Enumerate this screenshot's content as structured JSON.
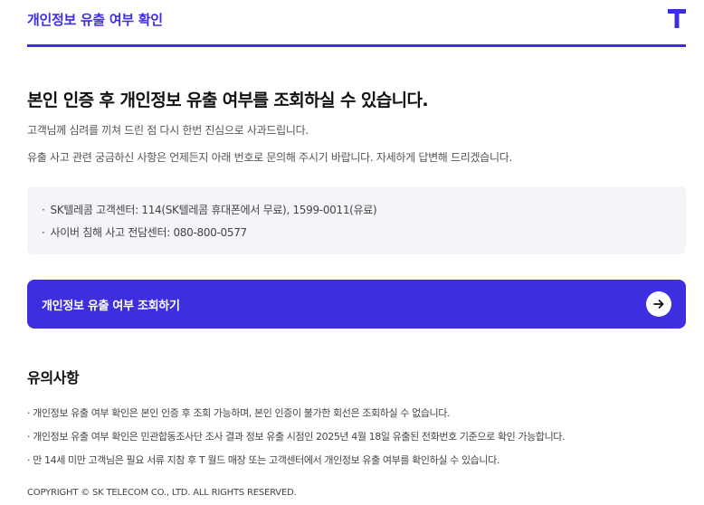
{
  "header": {
    "title": "개인정보 유출 여부 확인",
    "logo_icon": "t-logo-icon"
  },
  "main": {
    "headline": "본인 인증 후 개인정보 유출 여부를 조회하실 수 있습니다.",
    "description": [
      "고객님께 심려를 끼쳐 드린 점 다시 한번 진심으로 사과드립니다.",
      "유출 사고 관련 궁금하신 사항은 언제든지 아래 번호로 문의해 주시기 바랍니다. 자세하게 답변해 드리겠습니다."
    ],
    "contacts": [
      "SK텔레콤 고객센터: 114(SK텔레콤 휴대폰에서 무료), 1599-0011(유료)",
      "사이버 침해 사고 전담센터: 080-800-0577"
    ],
    "contact_bullet": "·",
    "cta": {
      "label": "개인정보 유출 여부 조회하기",
      "icon": "arrow-right-icon"
    }
  },
  "notes": {
    "title": "유의사항",
    "items": [
      "· 개인정보 유출 여부 확인은 본인 인증 후 조회 가능하며, 본인 인증이 불가한 회선은 조회하실 수 없습니다.",
      "· 개인정보 유출 여부 확인은 민관합동조사단 조사 결과 정보 유출 시점인 2025년 4월 18일 유출된 전화번호 기준으로 확인 가능합니다.",
      "· 만 14세 미만 고객님은 필요 서류 지참 후 T 월드 매장 또는 고객센터에서 개인정보 유출 여부를 확인하실 수 있습니다."
    ]
  },
  "footer": {
    "copyright": "COPYRIGHT © SK TELECOM CO., LTD. ALL RIGHTS RESERVED."
  },
  "colors": {
    "accent": "#3d2ee0",
    "box_background": "#f4f5f8",
    "text_primary": "#111111",
    "text_secondary": "#555555"
  }
}
